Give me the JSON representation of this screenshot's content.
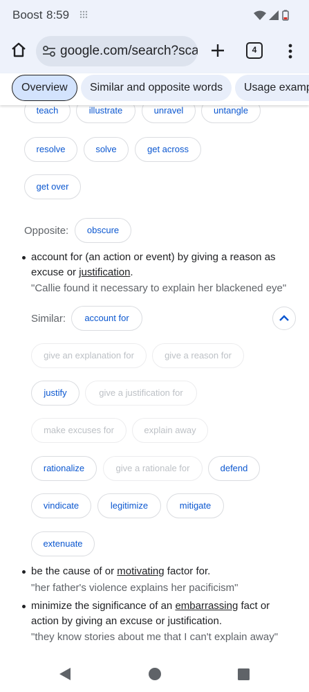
{
  "status": {
    "carrier": "Boost",
    "time": "8:59"
  },
  "browser": {
    "url": "google.com/search?sca_",
    "tab_count": "4"
  },
  "tabs": [
    {
      "label": "Overview"
    },
    {
      "label": "Similar and opposite words"
    },
    {
      "label": "Usage examp"
    }
  ],
  "sense1": {
    "similar_row1": [
      "teach",
      "illustrate",
      "unravel",
      "untangle"
    ],
    "similar_row2": [
      "resolve",
      "solve",
      "get across"
    ],
    "similar_row3": [
      "get over"
    ],
    "opposite_label": "Opposite:",
    "opposite": [
      "obscure"
    ]
  },
  "sense2": {
    "def_before": "account for (an action or event) by giving a reason as excuse or ",
    "def_link": "justification",
    "def_after": ".",
    "example": "\"Callie found it necessary to explain her blackened eye\"",
    "similar_label": "Similar:",
    "similar_first": "account for",
    "similar": [
      {
        "text": "give an explanation for",
        "muted": true
      },
      {
        "text": "give a reason for",
        "muted": true
      },
      {
        "text": "justify",
        "muted": false
      },
      {
        "text": "give a justification for",
        "muted": true
      },
      {
        "text": "make excuses for",
        "muted": true
      },
      {
        "text": "explain away",
        "muted": true
      },
      {
        "text": "rationalize",
        "muted": false
      },
      {
        "text": "give a rationale for",
        "muted": true
      },
      {
        "text": "defend",
        "muted": false
      },
      {
        "text": "vindicate",
        "muted": false
      },
      {
        "text": "legitimize",
        "muted": false
      },
      {
        "text": "mitigate",
        "muted": false
      },
      {
        "text": "extenuate",
        "muted": false
      }
    ]
  },
  "sense3": {
    "def_before": "be the cause of or ",
    "def_link": "motivating",
    "def_after": " factor for.",
    "example": "\"her father's violence explains her pacificism\""
  },
  "sense4": {
    "def_before": "minimize the significance of an ",
    "def_link": "embarrassing",
    "def_after": " fact or action by giving an excuse or justification.",
    "example": "\"they know stories about me that I can't explain away\""
  },
  "colors": {
    "link": "#0b57d0",
    "muted": "#bdc1c6",
    "chrome": "#eef2fb"
  },
  "icons": [
    "grid-dots-icon",
    "wifi-icon",
    "signal-icon",
    "battery-icon",
    "home-icon",
    "tune-icon",
    "plus-icon",
    "tab-switcher-icon",
    "more-vert-icon",
    "chevron-up-icon",
    "back-icon",
    "home-circle-icon",
    "recents-icon"
  ]
}
